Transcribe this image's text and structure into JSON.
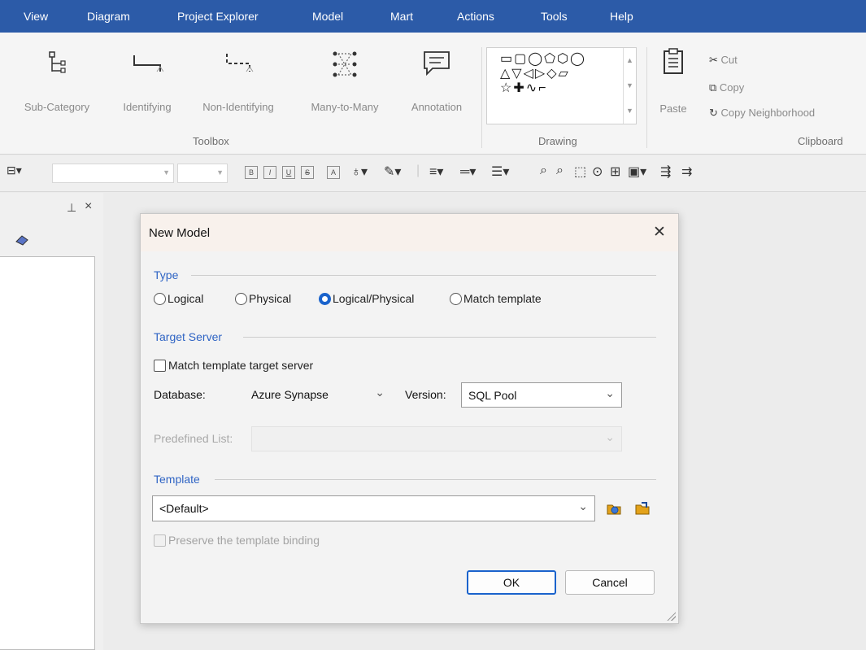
{
  "menu": [
    "View",
    "Diagram",
    "Project Explorer",
    "Model",
    "Mart",
    "Actions",
    "Tools",
    "Help"
  ],
  "ribbon": {
    "toolbox": {
      "items": [
        "Sub-Category",
        "Identifying",
        "Non-Identifying",
        "Many-to-Many",
        "Annotation"
      ],
      "label": "Toolbox"
    },
    "drawing": {
      "label": "Drawing",
      "shape_rows": [
        "▭▢◯⬠⬡◯",
        "△▽◁▷◇▱",
        "☆✚∿⌐"
      ]
    },
    "clipboard": {
      "paste": "Paste",
      "cut": "Cut",
      "copy": "Copy",
      "copy_neighborhood": "Copy Neighborhood",
      "label": "Clipboard"
    }
  },
  "format_toolbar": {
    "buttons": [
      "B",
      "I",
      "U",
      "S",
      "A"
    ]
  },
  "dialog": {
    "title": "New Model",
    "type_section": "Type",
    "type_options": [
      "Logical",
      "Physical",
      "Logical/Physical",
      "Match template"
    ],
    "selected_type": "Logical/Physical",
    "target_section": "Target Server",
    "match_template_server": "Match template target server",
    "database_label": "Database:",
    "database_value": "Azure Synapse",
    "version_label": "Version:",
    "version_value": "SQL Pool",
    "predefined_label": "Predefined List:",
    "predefined_value": "",
    "template_section": "Template",
    "template_value": "<Default>",
    "preserve_binding": "Preserve the template binding",
    "ok": "OK",
    "cancel": "Cancel"
  },
  "colors": {
    "menubar": "#2c5ba8",
    "accent": "#1a63cc",
    "section": "#2f64c4"
  }
}
